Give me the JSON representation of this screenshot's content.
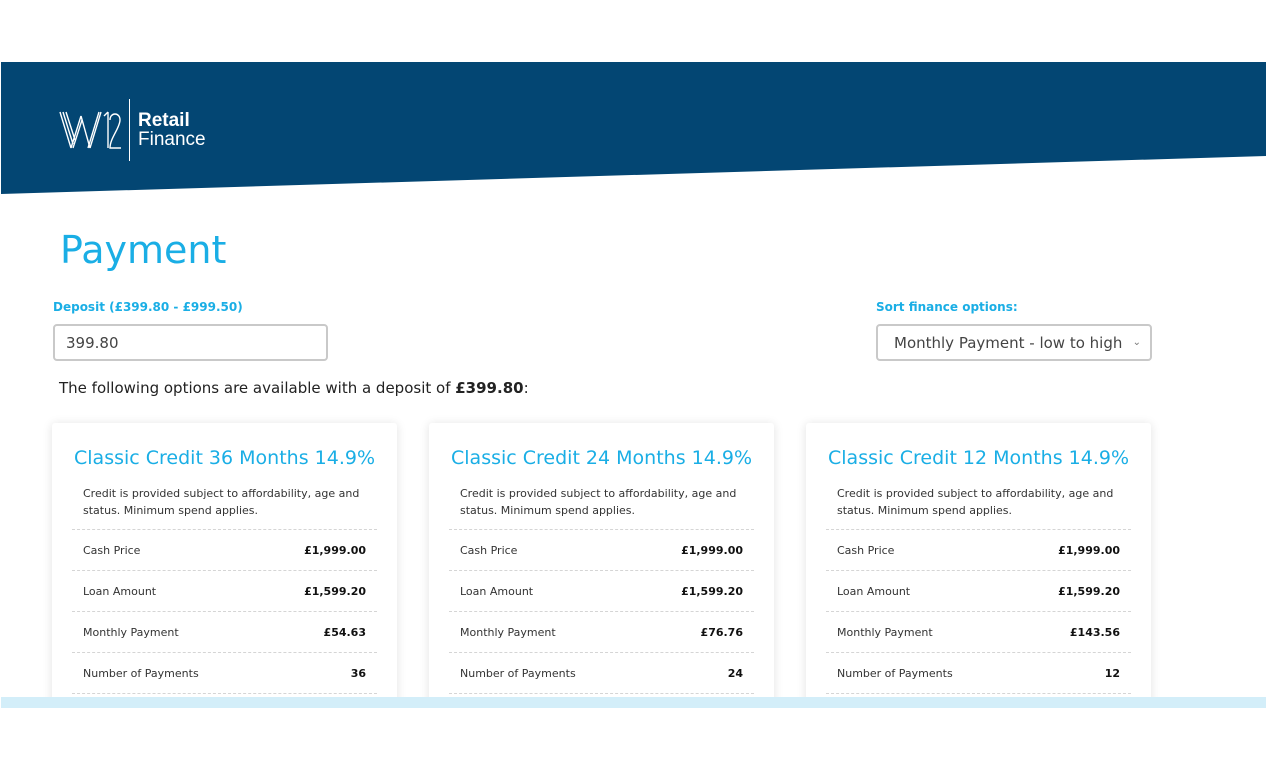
{
  "brand": {
    "name_line1": "Retail",
    "name_line2": "Finance",
    "header_color": "#034673",
    "accent_color": "#1aaee5"
  },
  "page": {
    "title": "Payment"
  },
  "deposit": {
    "label": "Deposit (£399.80 - £999.50)",
    "value": "399.80"
  },
  "sort": {
    "label": "Sort finance options:",
    "selected": "Monthly Payment - low to high"
  },
  "options_text": {
    "prefix": "The following options are available with a deposit of ",
    "amount": "£399.80",
    "suffix": ":"
  },
  "cards": [
    {
      "title": "Classic Credit 36 Months 14.9%",
      "description": "Credit is provided subject to affordability, age and status. Minimum spend applies.",
      "rows": [
        {
          "label": "Cash Price",
          "value": "£1,999.00"
        },
        {
          "label": "Loan Amount",
          "value": "£1,599.20"
        },
        {
          "label": "Monthly Payment",
          "value": "£54.63"
        },
        {
          "label": "Number of Payments",
          "value": "36"
        }
      ]
    },
    {
      "title": "Classic Credit 24 Months 14.9%",
      "description": "Credit is provided subject to affordability, age and status. Minimum spend applies.",
      "rows": [
        {
          "label": "Cash Price",
          "value": "£1,999.00"
        },
        {
          "label": "Loan Amount",
          "value": "£1,599.20"
        },
        {
          "label": "Monthly Payment",
          "value": "£76.76"
        },
        {
          "label": "Number of Payments",
          "value": "24"
        }
      ]
    },
    {
      "title": "Classic Credit 12 Months 14.9%",
      "description": "Credit is provided subject to affordability, age and status. Minimum spend applies.",
      "rows": [
        {
          "label": "Cash Price",
          "value": "£1,999.00"
        },
        {
          "label": "Loan Amount",
          "value": "£1,599.20"
        },
        {
          "label": "Monthly Payment",
          "value": "£143.56"
        },
        {
          "label": "Number of Payments",
          "value": "12"
        }
      ]
    }
  ]
}
